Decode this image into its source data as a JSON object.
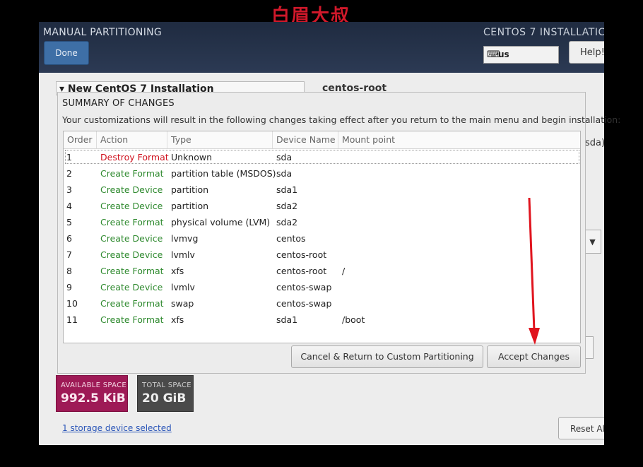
{
  "watermark": "白眉大叔",
  "header": {
    "title": "MANUAL PARTITIONING",
    "done_label": "Done",
    "right_title": "CENTOS 7 INSTALLATIC",
    "keyboard_layout": "us",
    "help_label": "Help!"
  },
  "background": {
    "group_title": "New CentOS 7 Installation",
    "selected_device": "centos-root",
    "partial_sda": "sda)",
    "combo_arrow": "▼",
    "available_space_label": "AVAILABLE SPACE",
    "available_space_value": "992.5 KiB",
    "total_space_label": "TOTAL SPACE",
    "total_space_value": "20 GiB",
    "storage_link": "1 storage device selected",
    "reset_label": "Reset Al"
  },
  "dialog": {
    "title": "SUMMARY OF CHANGES",
    "description": "Your customizations will result in the following changes taking effect after you return to the main menu and begin installation:",
    "columns": [
      "Order",
      "Action",
      "Type",
      "Device Name",
      "Mount point"
    ],
    "rows": [
      {
        "order": "1",
        "action": "Destroy Format",
        "type": "Unknown",
        "device": "sda",
        "mount": ""
      },
      {
        "order": "2",
        "action": "Create Format",
        "type": "partition table (MSDOS)",
        "device": "sda",
        "mount": ""
      },
      {
        "order": "3",
        "action": "Create Device",
        "type": "partition",
        "device": "sda1",
        "mount": ""
      },
      {
        "order": "4",
        "action": "Create Device",
        "type": "partition",
        "device": "sda2",
        "mount": ""
      },
      {
        "order": "5",
        "action": "Create Format",
        "type": "physical volume (LVM)",
        "device": "sda2",
        "mount": ""
      },
      {
        "order": "6",
        "action": "Create Device",
        "type": "lvmvg",
        "device": "centos",
        "mount": ""
      },
      {
        "order": "7",
        "action": "Create Device",
        "type": "lvmlv",
        "device": "centos-root",
        "mount": ""
      },
      {
        "order": "8",
        "action": "Create Format",
        "type": "xfs",
        "device": "centos-root",
        "mount": "/"
      },
      {
        "order": "9",
        "action": "Create Device",
        "type": "lvmlv",
        "device": "centos-swap",
        "mount": ""
      },
      {
        "order": "10",
        "action": "Create Format",
        "type": "swap",
        "device": "centos-swap",
        "mount": ""
      },
      {
        "order": "11",
        "action": "Create Format",
        "type": "xfs",
        "device": "sda1",
        "mount": "/boot"
      }
    ],
    "cancel_label": "Cancel & Return to Custom Partitioning",
    "accept_label": "Accept Changes"
  },
  "colors": {
    "destroy_action": "#d0131f",
    "create_action": "#2f8a2f",
    "annotation_arrow": "#e0141e"
  }
}
